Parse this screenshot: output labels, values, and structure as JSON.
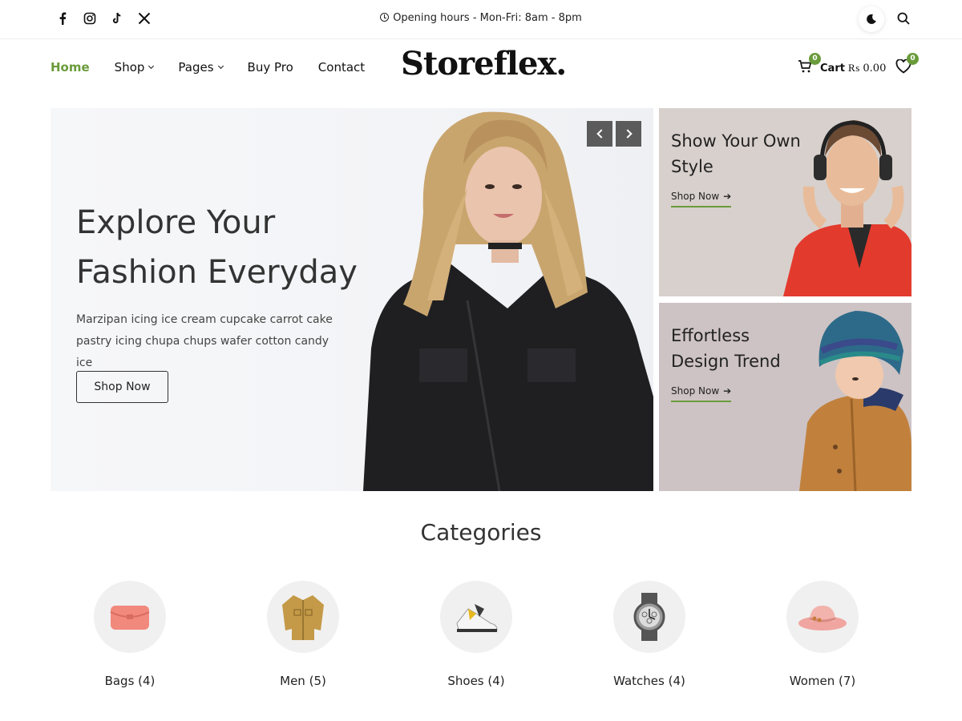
{
  "topbar": {
    "social": [
      "facebook-icon",
      "instagram-icon",
      "tiktok-icon",
      "x-icon"
    ],
    "hours": "Opening hours - Mon-Fri: 8am - 8pm"
  },
  "header": {
    "nav": [
      {
        "label": "Home",
        "active": true
      },
      {
        "label": "Shop",
        "dropdown": true
      },
      {
        "label": "Pages",
        "dropdown": true
      },
      {
        "label": "Buy Pro"
      },
      {
        "label": "Contact"
      }
    ],
    "logo": "Storeflex.",
    "cart": {
      "count": "0",
      "label": "Cart",
      "total": "₨ 0.00"
    },
    "wishlist": {
      "count": "0"
    }
  },
  "hero": {
    "title_line1": "Explore Your",
    "title_line2": "Fashion Everyday",
    "description": "Marzipan icing ice cream cupcake carrot cake pastry icing chupa chups wafer cotton candy ice",
    "button": "Shop Now"
  },
  "promos": [
    {
      "title": "Show Your Own Style",
      "link": "Shop Now"
    },
    {
      "title": "Effortless Design Trend",
      "link": "Shop Now"
    }
  ],
  "categories": {
    "title": "Categories",
    "items": [
      {
        "label": "Bags (4)",
        "icon": "bag-icon"
      },
      {
        "label": "Men (5)",
        "icon": "shirt-icon"
      },
      {
        "label": "Shoes (4)",
        "icon": "shoe-icon"
      },
      {
        "label": "Watches (4)",
        "icon": "watch-icon"
      },
      {
        "label": "Women (7)",
        "icon": "hat-icon"
      }
    ]
  },
  "colors": {
    "accent": "#6a9b3b",
    "text": "#222222",
    "hero_bg": "#f4f5f8"
  }
}
